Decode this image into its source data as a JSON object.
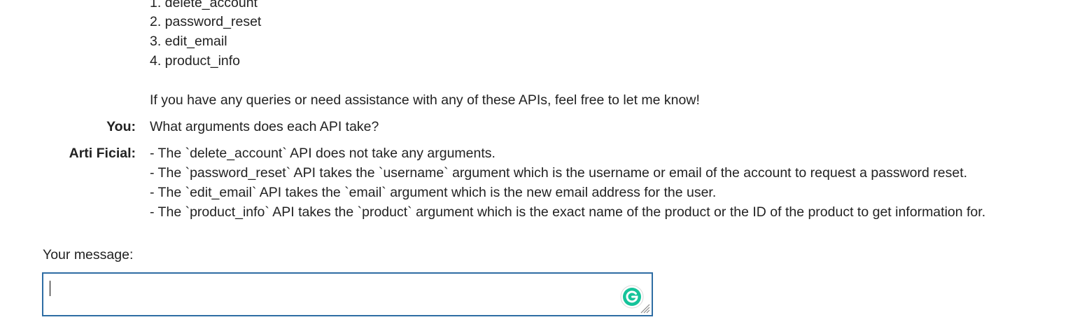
{
  "conversation": {
    "list_items": [
      "1. delete_account",
      "2. password_reset",
      "3. edit_email",
      "4. product_info"
    ],
    "closing_text": "If you have any queries or need assistance with any of these APIs, feel free to let me know!",
    "user_speaker": "You:",
    "user_message": "What arguments does each API take?",
    "assistant_speaker": "Arti Ficial:",
    "assistant_lines": [
      "- The `delete_account` API does not take any arguments.",
      "- The `password_reset` API takes the `username` argument which is the username or email of the account to request a password reset.",
      "- The `edit_email` API takes the `email` argument which is the new email address for the user.",
      "- The `product_info` API takes the `product` argument which is the exact name of the product or the ID of the product to get information for."
    ]
  },
  "composer": {
    "label": "Your message:",
    "value": "",
    "grammar_icon": "grammarly-icon",
    "resize_icon": "resize-grip-icon"
  },
  "colors": {
    "input_border": "#2e6da4",
    "grammarly_green": "#15c39a"
  }
}
